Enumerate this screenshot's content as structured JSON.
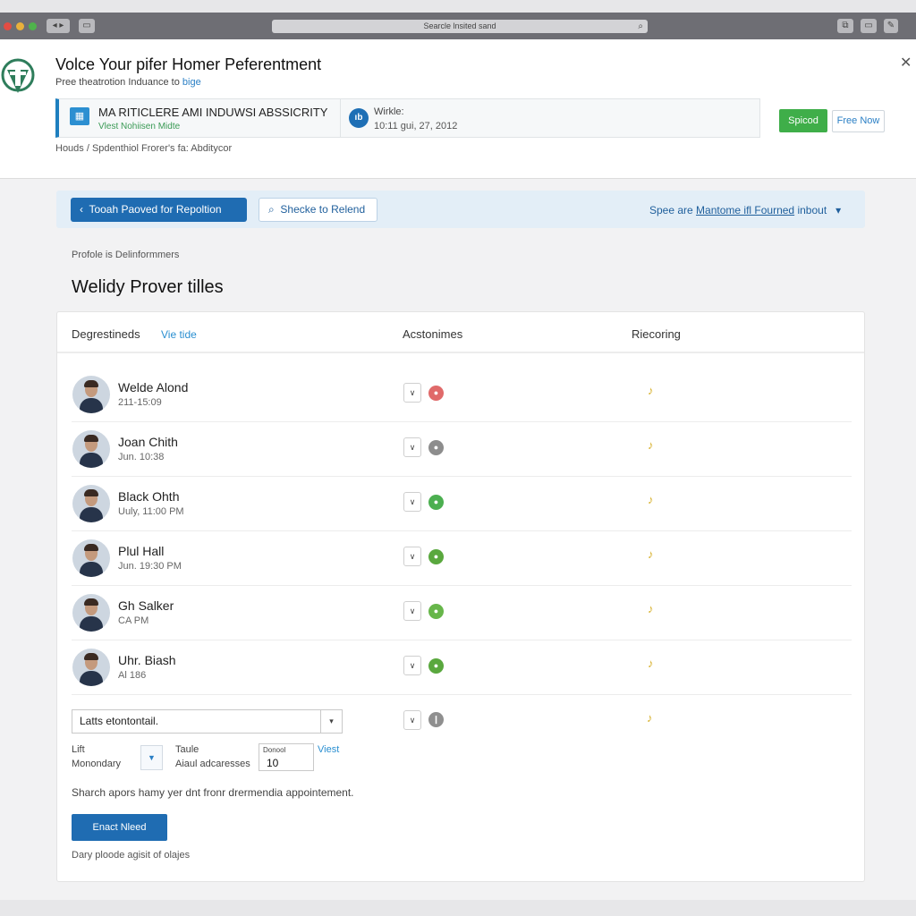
{
  "browser": {
    "url": "Searcle lnsited sand",
    "tab_btn_1": "◂ ▸",
    "tab_btn_2": "▭"
  },
  "header": {
    "title": "Volce Your pifer Homer Peferentment",
    "subtitle_prefix": "Pree theatrotion Induance to",
    "subtitle_link": "bige",
    "org_name": "MA RITICLERE AMI INDUWSI ABSSICRITY",
    "org_sub": "Vlest Nohiisen Midte",
    "wh_label": "Wirkle:",
    "wh_date": "10:11 gui, 27, 2012",
    "btn_primary": "Spicod",
    "btn_secondary": "Free Now",
    "breadcrumb": "Houds / Spdenthiol Frorer's fa: Abditycor"
  },
  "toolbar": {
    "primary_btn": "Tooah Paoved for Repoltion",
    "search_btn": "Shecke to Relend",
    "right_prefix": "Spee are",
    "right_link": "Mantome ifl Fourned",
    "right_suffix": "inbout"
  },
  "main": {
    "section_label": "Profole is Delinformmers",
    "heading": "Welidy Prover tilles"
  },
  "table": {
    "col1": "Degrestineds",
    "col1_link": "Vie tide",
    "col2": "Acstonimes",
    "col3": "Riecoring",
    "rows": [
      {
        "name": "Welde Alond",
        "meta": "211-15:09",
        "status_color": "#e06a6a"
      },
      {
        "name": "Joan Chith",
        "meta": "Jun. 10:38",
        "status_color": "#8d8d8d"
      },
      {
        "name": "Black Ohth",
        "meta": "Uuly, 11:00 PM",
        "status_color": "#4caf50"
      },
      {
        "name": "Plul Hall",
        "meta": "Jun. 19:30 PM",
        "status_color": "#5aa83e"
      },
      {
        "name": "Gh Salker",
        "meta": "CA PM",
        "status_color": "#67b64a"
      },
      {
        "name": "Uhr. Biash",
        "meta": "Al 186",
        "status_color": "#5aa83e"
      }
    ]
  },
  "form": {
    "select_value": "Latts etontontail.",
    "lift_label": "Lift",
    "lift_value": "Monondary",
    "taule_label": "Taule",
    "taule_value": "Aiaul adcaresses",
    "num_label": "Donool",
    "num_value": "10",
    "viest": "Viest",
    "note": "Sharch apors hamy yer dnt fronr drermendia appointement.",
    "submit": "Enact Nleed",
    "footnote": "Dary ploode agisit of olajes"
  }
}
